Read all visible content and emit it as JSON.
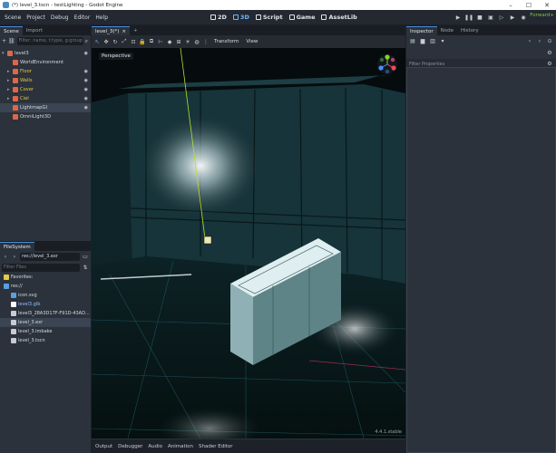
{
  "window": {
    "title": "(*) level_3.tscn - testLighting - Godot Engine",
    "controls": [
      "–",
      "☐",
      "✕"
    ]
  },
  "menubar": {
    "items": [
      "Scene",
      "Project",
      "Debug",
      "Editor",
      "Help"
    ],
    "workspaces": [
      "2D",
      "3D",
      "Script",
      "Game",
      "AssetLib"
    ],
    "active_workspace": "3D",
    "renderer": "Forward+"
  },
  "scene_dock": {
    "tabs": [
      "Scene",
      "Import"
    ],
    "filter_placeholder": "Filter: name, t:type, g:group",
    "nodes": [
      {
        "name": "level3",
        "depth": 0,
        "color": "#e0664a",
        "expanded": true
      },
      {
        "name": "WorldEnvironment",
        "depth": 1,
        "color": "#e0664a"
      },
      {
        "name": "Floor",
        "depth": 1,
        "color": "#e0664a",
        "collapsed": true
      },
      {
        "name": "Walls",
        "depth": 1,
        "color": "#e0664a",
        "collapsed": true
      },
      {
        "name": "Cover",
        "depth": 1,
        "color": "#e0664a",
        "collapsed": true
      },
      {
        "name": "Ciel",
        "depth": 1,
        "color": "#e0664a",
        "collapsed": true
      },
      {
        "name": "LightmapGI",
        "depth": 1,
        "color": "#e0664a",
        "selected": true
      },
      {
        "name": "OmniLight3D",
        "depth": 1,
        "color": "#e0664a"
      }
    ]
  },
  "filesystem": {
    "tab": "FileSystem",
    "path": "res://level_3.exr",
    "filter_placeholder": "Filter Files",
    "items": [
      {
        "name": "Favorites:",
        "depth": 0,
        "color": "#e6c84a"
      },
      {
        "name": "res://",
        "depth": 0,
        "color": "#5aa0e0"
      },
      {
        "name": "icon.svg",
        "depth": 1,
        "color": "#5aa0e0"
      },
      {
        "name": "level3.glb",
        "depth": 1,
        "color": "#ffffff",
        "name_color": "#8fc0ff"
      },
      {
        "name": "level3_28A3D17F-F91D-43AD...",
        "depth": 1,
        "color": "#c8ccd2"
      },
      {
        "name": "level_3.exr",
        "depth": 1,
        "color": "#c8ccd2",
        "selected": true
      },
      {
        "name": "level_3.lmbake",
        "depth": 1,
        "color": "#c8ccd2"
      },
      {
        "name": "level_3.tscn",
        "depth": 1,
        "color": "#c8ccd2"
      }
    ]
  },
  "editor": {
    "tab_label": "level_3(*)",
    "tab_close": "×",
    "menus": [
      "Transform",
      "View"
    ],
    "viewport_label": "Perspective",
    "version": "4.4.1.stable"
  },
  "bottom_panel": {
    "tabs": [
      "Output",
      "Debugger",
      "Audio",
      "Animation",
      "Shader Editor"
    ]
  },
  "inspector": {
    "tabs": [
      "Inspector",
      "Node",
      "History"
    ],
    "filter_placeholder": "Filter Properties"
  }
}
